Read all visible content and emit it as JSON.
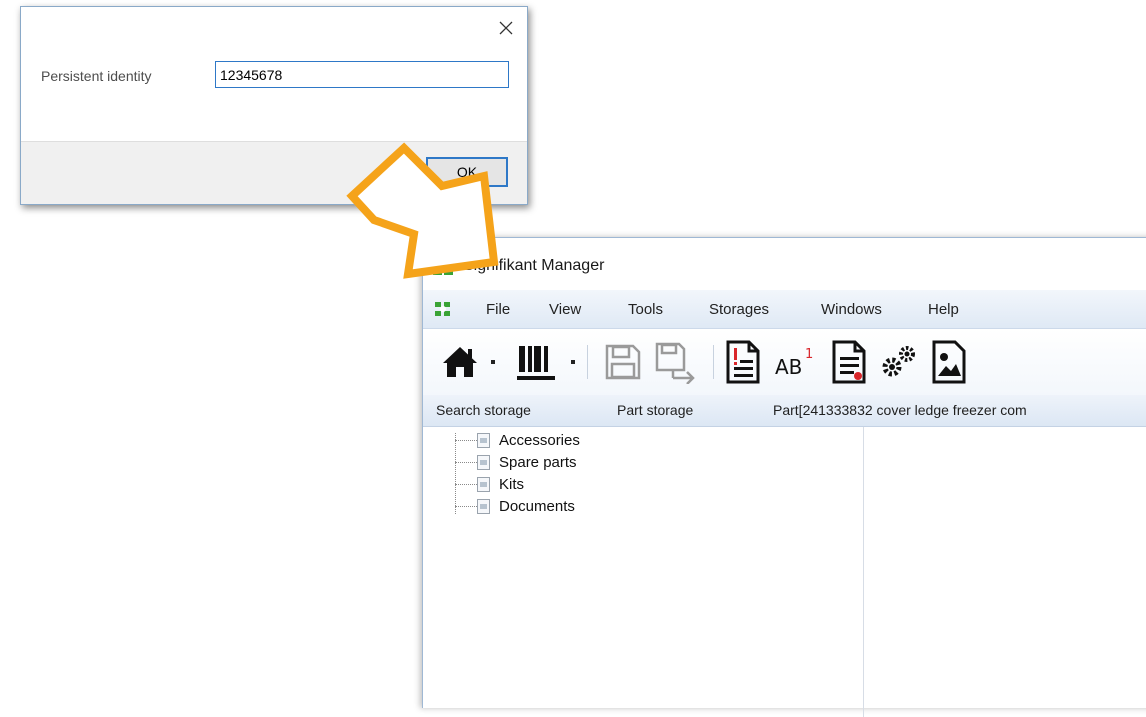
{
  "dialog": {
    "label": "Persistent identity",
    "input_value": "12345678",
    "ok_label": "OK"
  },
  "app": {
    "title": "Signifikant Manager",
    "menu": [
      "File",
      "View",
      "Tools",
      "Storages",
      "Windows",
      "Help"
    ],
    "toolbar_icons": [
      "home-icon",
      "barcode-icon",
      "save-icon",
      "save-as-icon",
      "document-alert-icon",
      "superscript-text-icon",
      "document-edit-icon",
      "settings-gears-icon",
      "image-icon"
    ],
    "breadcrumbs": [
      "Search storage",
      "Part storage",
      "Part[241333832 cover ledge freezer com"
    ],
    "tree": [
      "Accessories",
      "Spare parts",
      "Kits",
      "Documents"
    ]
  },
  "colors": {
    "accent": "#2e78c7",
    "arrow": "#f5a31a",
    "logo_green": "#3aa335"
  }
}
